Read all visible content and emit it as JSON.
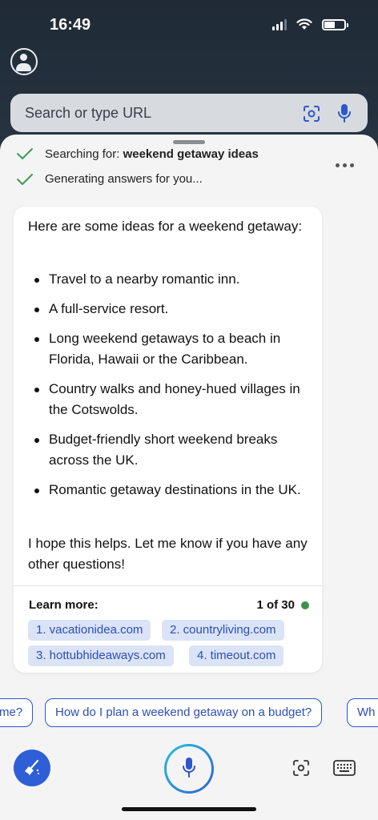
{
  "status": {
    "time": "16:49"
  },
  "search": {
    "placeholder": "Search or type URL"
  },
  "progress": {
    "searching_prefix": "Searching for: ",
    "searching_query": "weekend getaway ideas",
    "generating": "Generating answers for you..."
  },
  "answer": {
    "intro": "Here are some ideas for a weekend getaway:",
    "items": [
      "Travel to a nearby romantic inn.",
      "A full-service resort.",
      "Long weekend getaways to a beach in Florida, Hawaii or the Caribbean.",
      "Country walks and honey-hued villages in the Cotswolds.",
      "Budget-friendly short weekend breaks across the UK.",
      "Romantic getaway destinations in the UK."
    ],
    "closing": "I hope this helps. Let me know if you have any other questions!",
    "learn_more_label": "Learn more:",
    "page_count": "1 of 30",
    "links": [
      "1. vacationidea.com",
      "2. countryliving.com",
      "3. hottubhideaways.com",
      "4. timeout.com"
    ]
  },
  "suggestions": [
    "me?",
    "How do I plan a weekend getaway on a budget?",
    "Wh"
  ],
  "colors": {
    "accent_blue": "#2d57c9",
    "link_chip_bg": "#dbe3f6",
    "status_green": "#3f8f4f",
    "check_green": "#3f9b55"
  }
}
